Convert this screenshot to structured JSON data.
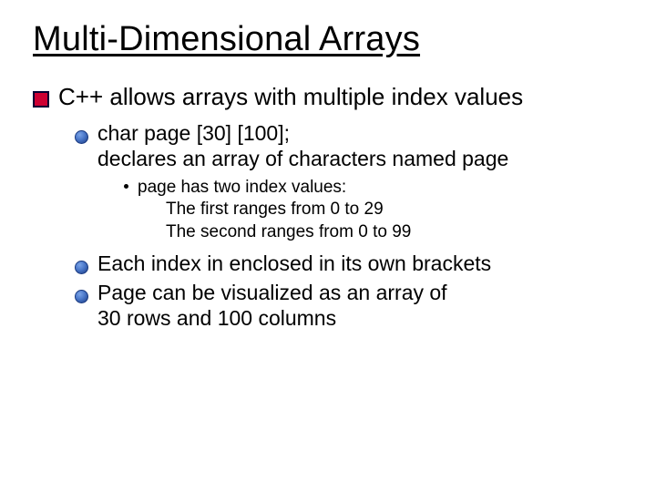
{
  "title": "Multi-Dimensional Arrays",
  "bullets": {
    "l1": "C++ allows arrays with multiple index values",
    "l2a_line1": "char page [30] [100];",
    "l2a_line2": "declares an array of characters named page",
    "l3_line1": "page has two index values:",
    "l3_line2": "The first ranges from 0 to 29",
    "l3_line3": "The second ranges from 0 to 99",
    "l2b": "Each index  in enclosed in its own brackets",
    "l2c_line1": "Page can be visualized as an array of",
    "l2c_line2": "30 rows and 100 columns"
  }
}
